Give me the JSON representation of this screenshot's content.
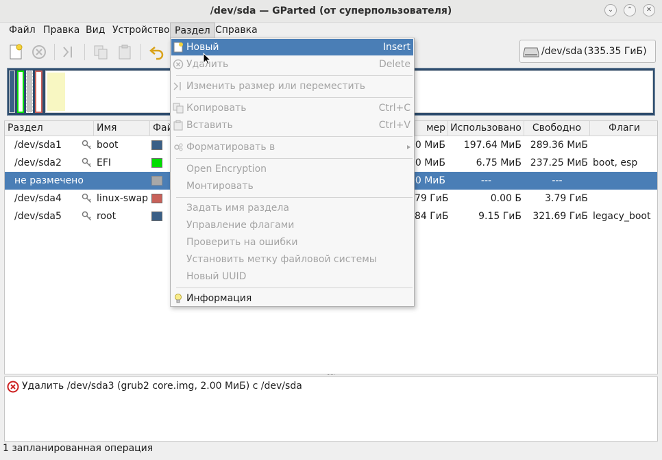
{
  "window": {
    "title": "/dev/sda — GParted (от суперпользователя)"
  },
  "menubar": {
    "items": [
      "Файл",
      "Правка",
      "Вид",
      "Устройство",
      "Раздел",
      "Справка"
    ]
  },
  "device": {
    "name": "/dev/sda",
    "size": "(335.35 ГиБ)"
  },
  "colors": {
    "selection": "#4a7eb6",
    "boot": "#3a5f86",
    "efi": "#00dd00",
    "unallocated": "#a8a8a8",
    "swap": "#c8615a",
    "root": "#3a5f86"
  },
  "table": {
    "headers": [
      "Раздел",
      "Имя",
      "Фай",
      "мер",
      "Использовано",
      "Свободно",
      "Флаги"
    ],
    "rows": [
      {
        "partition": "/dev/sda1",
        "name": "boot",
        "size": "0 МиБ",
        "used": "197.64 МиБ",
        "free": "289.36 МиБ",
        "flags": ""
      },
      {
        "partition": "/dev/sda2",
        "name": "EFI",
        "size": "0 МиБ",
        "used": "6.75 МиБ",
        "free": "237.25 МиБ",
        "flags": "boot, esp"
      },
      {
        "partition": "не размечено",
        "name": "",
        "size": "0 МиБ",
        "used": "---",
        "free": "---",
        "flags": ""
      },
      {
        "partition": "/dev/sda4",
        "name": "linux-swap",
        "size": "79 ГиБ",
        "used": "0.00 Б",
        "free": "3.79 ГиБ",
        "flags": ""
      },
      {
        "partition": "/dev/sda5",
        "name": "root",
        "size": "84 ГиБ",
        "used": "9.15 ГиБ",
        "free": "321.69 ГиБ",
        "flags": "legacy_boot"
      }
    ]
  },
  "operations": {
    "items": [
      "Удалить /dev/sda3 (grub2 core.img, 2.00 МиБ) с /dev/sda"
    ]
  },
  "status": {
    "text": "1 запланированная операция"
  },
  "partition_menu": {
    "new": {
      "label": "Новый",
      "accel": "Insert"
    },
    "delete": {
      "label": "Удалить",
      "accel": "Delete"
    },
    "resize": {
      "label": "Изменить размер или переместить"
    },
    "copy": {
      "label": "Копировать",
      "accel": "Ctrl+C"
    },
    "paste": {
      "label": "Вставить",
      "accel": "Ctrl+V"
    },
    "format": {
      "label": "Форматировать в"
    },
    "open_encryption": {
      "label": "Open Encryption"
    },
    "mount": {
      "label": "Монтировать"
    },
    "set_name": {
      "label": "Задать имя раздела"
    },
    "flags": {
      "label": "Управление флагами"
    },
    "check": {
      "label": "Проверить на ошибки"
    },
    "label_fs": {
      "label": "Установить метку файловой системы"
    },
    "new_uuid": {
      "label": "Новый UUID"
    },
    "info": {
      "label": "Информация"
    }
  }
}
